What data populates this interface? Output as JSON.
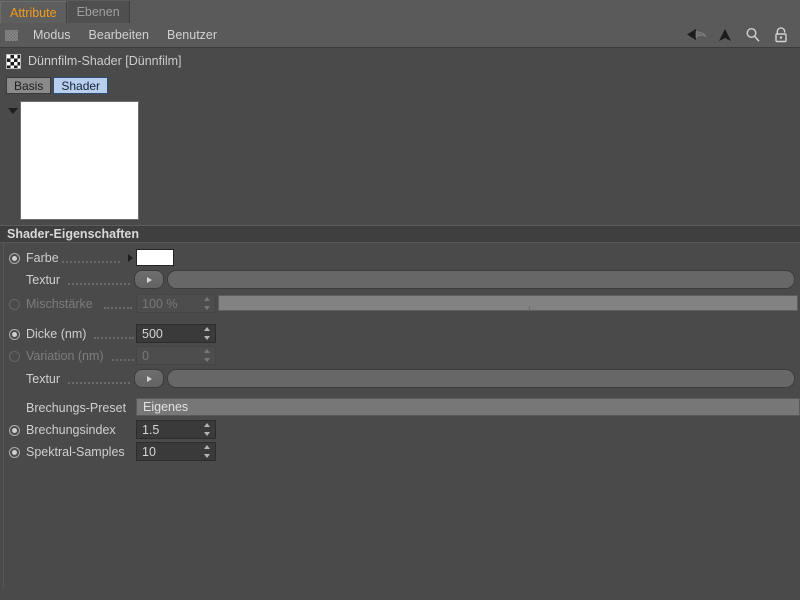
{
  "window": {
    "tabs": [
      {
        "label": "Attribute",
        "active": true
      },
      {
        "label": "Ebenen",
        "active": false
      }
    ]
  },
  "menubar": {
    "grip_icon": "grip-dots-icon",
    "items": [
      "Modus",
      "Bearbeiten",
      "Benutzer"
    ],
    "right_icons": [
      "back-arrow-icon",
      "up-arrow-icon",
      "search-icon",
      "lock-icon"
    ]
  },
  "object": {
    "icon": "checkerboard-shader-icon",
    "title": "Dünnfilm-Shader [Dünnfilm]",
    "subtabs": [
      {
        "label": "Basis",
        "selected": false
      },
      {
        "label": "Shader",
        "selected": true
      }
    ]
  },
  "preview": {
    "collapse_icon": "triangle-down-icon",
    "swatch_color": "#ffffff"
  },
  "groups": [
    {
      "title": "Shader-Eigenschaften"
    }
  ],
  "properties": {
    "farbe": {
      "label": "Farbe",
      "color": "#ffffff"
    },
    "textur_farbe": {
      "label": "Textur",
      "value": ""
    },
    "mischstaerke": {
      "label": "Mischstärke",
      "value": "100 %",
      "slider_percent": 100,
      "enabled": false
    },
    "dicke": {
      "label": "Dicke (nm)",
      "value": "500",
      "enabled": true
    },
    "variation": {
      "label": "Variation (nm)",
      "value": "0",
      "enabled": false
    },
    "textur_dicke": {
      "label": "Textur",
      "value": ""
    },
    "brechungs_preset": {
      "label": "Brechungs-Preset",
      "value": "Eigenes"
    },
    "brechungsindex": {
      "label": "Brechungsindex",
      "value": "1.5",
      "enabled": true
    },
    "spektral_samples": {
      "label": "Spektral-Samples",
      "value": "10",
      "enabled": true
    }
  },
  "colors": {
    "panel_bg": "#4a4a4a",
    "header_bg": "#5a5a5a",
    "accent_tab": "#f49a1e",
    "selected_tab": "#b8cfee",
    "group_header_bg": "#3f3f3f"
  }
}
